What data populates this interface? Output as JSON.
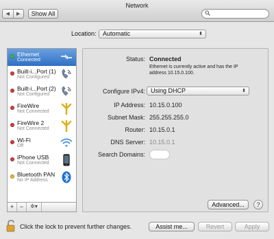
{
  "window": {
    "title": "Network"
  },
  "toolbar": {
    "back_glyph": "◀",
    "forward_glyph": "▶",
    "show_all_label": "Show All",
    "search_placeholder": "",
    "search_icon": "magnifier-icon"
  },
  "location": {
    "label": "Location:",
    "value": "Automatic"
  },
  "services": [
    {
      "name": "Ethernet",
      "status": "Connected",
      "dot_color": "#3cbd3c",
      "icon": "ethernet-icon",
      "selected": true
    },
    {
      "name": "Built-i...Port (1)",
      "status": "Not Configured",
      "dot_color": "#d63b3b",
      "icon": "phone-modem-icon"
    },
    {
      "name": "Built-i...Port (2)",
      "status": "Not Configured",
      "dot_color": "#d63b3b",
      "icon": "phone-modem-icon"
    },
    {
      "name": "FireWire",
      "status": "Not Connected",
      "dot_color": "#d63b3b",
      "icon": "firewire-icon"
    },
    {
      "name": "FireWire 2",
      "status": "Not Connected",
      "dot_color": "#d63b3b",
      "icon": "firewire-icon"
    },
    {
      "name": "Wi-Fi",
      "status": "Off",
      "dot_color": "#d63b3b",
      "icon": "wifi-icon"
    },
    {
      "name": "iPhone USB",
      "status": "Not Connected",
      "dot_color": "#d63b3b",
      "icon": "iphone-icon"
    },
    {
      "name": "Bluetooth PAN",
      "status": "No IP Address",
      "dot_color": "#e8b431",
      "icon": "bluetooth-icon"
    }
  ],
  "sidebar_footer": {
    "add": "+",
    "remove": "−",
    "action": "✲▾"
  },
  "detail": {
    "status_label": "Status:",
    "status_value": "Connected",
    "status_description": "Ethernet is currently active and has the IP address 10.15.0.100.",
    "configure_label": "Configure IPv4:",
    "configure_value": "Using DHCP",
    "ip_label": "IP Address:",
    "ip_value": "10.15.0.100",
    "subnet_label": "Subnet Mask:",
    "subnet_value": "255.255.255.0",
    "router_label": "Router:",
    "router_value": "10.15.0.1",
    "dns_label": "DNS Server:",
    "dns_value": "10.15.0.1",
    "domains_label": "Search Domains:",
    "domains_value": ""
  },
  "buttons": {
    "advanced": "Advanced...",
    "help": "?",
    "assist": "Assist me...",
    "revert": "Revert",
    "apply": "Apply"
  },
  "lock": {
    "text": "Click the lock to prevent further changes."
  }
}
